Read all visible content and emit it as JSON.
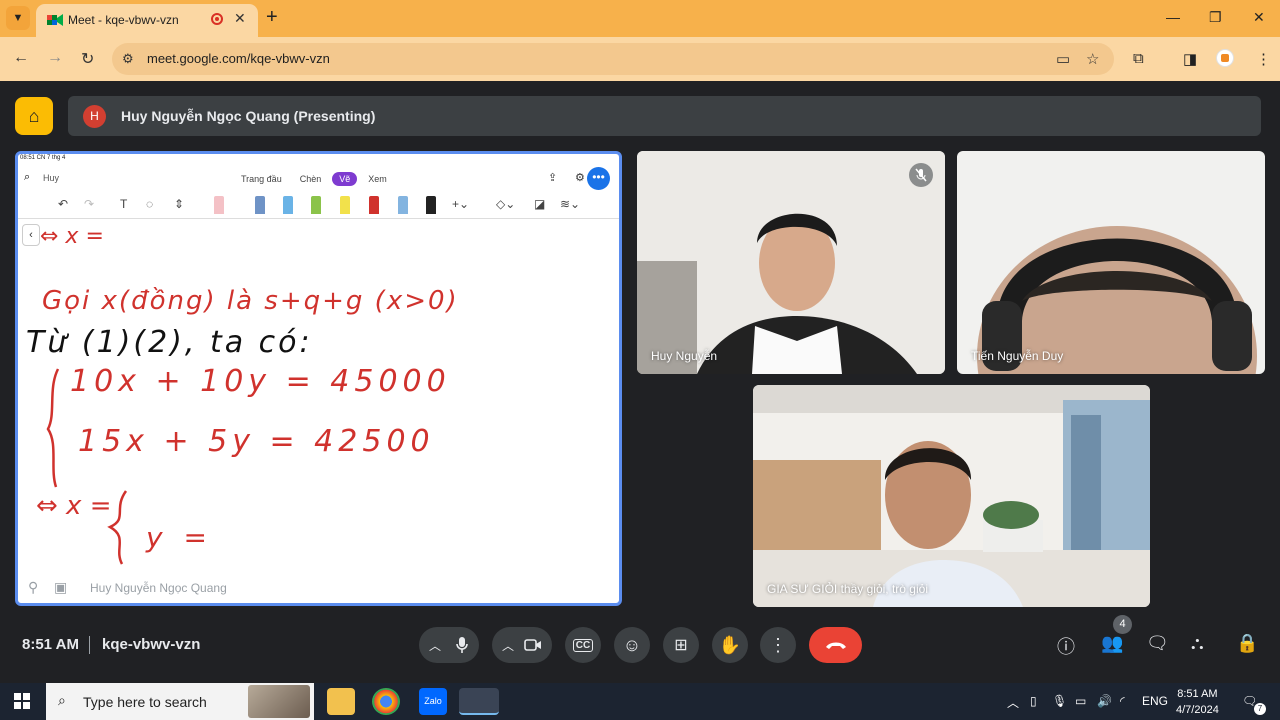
{
  "browser": {
    "tab_title": "Meet - kqe-vbwv-vzn",
    "url": "meet.google.com/kqe-vbwv-vzn"
  },
  "meet": {
    "presenter_initial": "H",
    "presenting_label": "Huy Nguyễn Ngọc Quang (Presenting)",
    "time": "8:51 AM",
    "meeting_code": "kqe-vbwv-vzn",
    "participant_count": "4"
  },
  "shared_screen": {
    "status_left": "08:51  CN 7 thg 4",
    "search_text": "Huy",
    "app_tabs": [
      "Trang đầu",
      "Chèn",
      "Vẽ",
      "Xem"
    ],
    "active_tab": "Vẽ",
    "presenter_watermark": "Huy Nguyễn Ngọc Quang",
    "handwriting": {
      "line1": "⇔ x =",
      "line2": "Gọi x(đồng) là s+q+g (x>0)",
      "line3": "Từ (1)(2), ta có:",
      "line4": "10x + 10y = 45000",
      "line5": "15x + 5y = 42500",
      "line6": "⇔ x =",
      "line7": "y ="
    }
  },
  "participants": [
    {
      "name": "Huy Nguyễn",
      "muted": true
    },
    {
      "name": "Tiến Nguyễn Duy",
      "muted": false
    },
    {
      "name": "GIA SƯ GIỎI thầy giỏi, trò giỏi",
      "muted": false
    }
  ],
  "taskbar": {
    "search_placeholder": "Type here to search",
    "language": "ENG",
    "clock_time": "8:51 AM",
    "clock_date": "4/7/2024",
    "notification_count": "7"
  },
  "colors": {
    "meet_bg": "#202124",
    "presenting_bar": "#3c4043",
    "hangup": "#ea4335",
    "meet_logo": "#fbbc04",
    "chrome_frame": "#f7b14b",
    "screen_border": "#5b8def",
    "ink_red": "#d0322d"
  }
}
